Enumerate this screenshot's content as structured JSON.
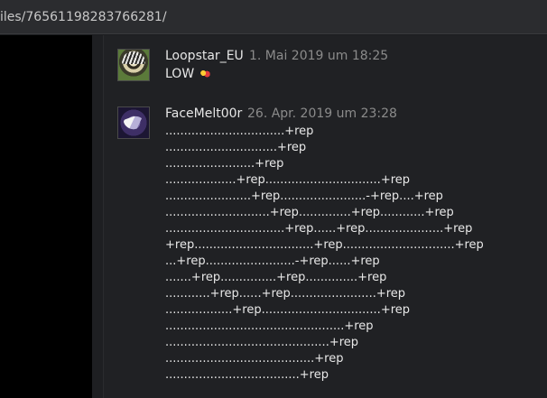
{
  "browser": {
    "url_fragment": "iles/76561198283766281/"
  },
  "comments": [
    {
      "author": "Loopstar_EU",
      "timestamp": "1. Mai 2019 um 18:25",
      "text": "LOW",
      "emoticon": "steam-emoticon"
    },
    {
      "author": "FaceMelt00r",
      "timestamp": "26. Apr. 2019 um 23:28",
      "lines": [
        "................................+rep",
        "..............................+rep",
        "........................+rep",
        "...................+rep...............................+rep",
        ".......................+rep.......................-+rep....+rep",
        "............................+rep..............+rep............+rep",
        "................................+rep......+rep.....................+rep",
        "+rep................................+rep..............................+rep",
        "...+rep........................-+rep......+rep",
        ".......+rep...............+rep..............+rep",
        "............+rep......+rep.......................+rep",
        "..................+rep................................+rep",
        "................................................+rep",
        "............................................+rep",
        "........................................+rep",
        "....................................+rep"
      ]
    }
  ]
}
